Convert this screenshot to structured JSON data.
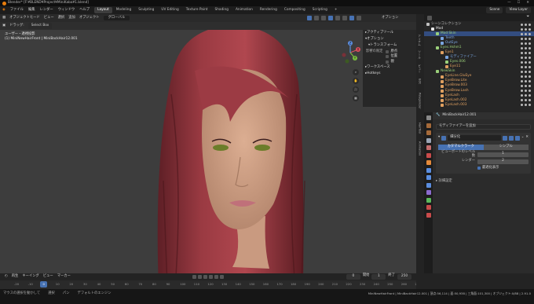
{
  "window": {
    "title": "Blender* [F:¥BLEND¥Project¥MiniKaba¥1.blend]",
    "controls": [
      "—",
      "☐",
      "✕"
    ]
  },
  "menubar": {
    "items": [
      "ファイル",
      "編集",
      "レンダー",
      "ウィンドウ",
      "ヘルプ"
    ],
    "workspaces": [
      "Layout",
      "Modeling",
      "Sculpting",
      "UV Editing",
      "Texture Paint",
      "Shading",
      "Animation",
      "Rendering",
      "Compositing",
      "Scripting",
      "+"
    ],
    "scene": "Scene",
    "view_layer": "View Layer"
  },
  "viewport": {
    "header": {
      "mode": "オブジェクトモード",
      "view": "ビュー",
      "select": "選択",
      "add": "追加",
      "object": "オブジェクト",
      "global": "グローバル",
      "options": "オプション"
    },
    "tool_header": {
      "items": [
        "ドラッグ:",
        "Select Box"
      ]
    },
    "info": [
      "ユーザー・透視投影",
      "(1) MiniNewHairFront | MiniBackHair12.001"
    ],
    "gizmo": {
      "x": "X",
      "y": "Y",
      "z": "Z"
    },
    "npanel": {
      "active_tool": "アクティブツール",
      "options": "オプション",
      "transform": "トランスフォーム",
      "affect_only": "影響の限定",
      "affect_items": [
        "原点",
        "位置",
        "親"
      ],
      "workspace": "ワークスペース",
      "hotkeys": "Hotkeys"
    },
    "nav_buttons": [
      "⌕",
      "✋",
      "🎥",
      "▦"
    ]
  },
  "side_tabs": [
    "アイテム",
    "ツール",
    "ビュー",
    "Edit",
    "Polygonizer",
    "HairTool",
    "Animation"
  ],
  "outliner": {
    "header": "",
    "rows": [
      {
        "name": "シーンコレクション",
        "indent": 0,
        "color": "#c0c0c0"
      },
      {
        "name": "Mod",
        "indent": 1,
        "color": "#e8e8e8"
      },
      {
        "name": "Mod Skin",
        "indent": 2,
        "color": "#9bd07a"
      },
      {
        "name": "Teeth",
        "indent": 3,
        "color": "#7aa5e0"
      },
      {
        "name": "OutEye",
        "indent": 3,
        "color": "#7aa5e0"
      },
      {
        "name": "Eyes.Hshm1",
        "indent": 2,
        "color": "#9bd07a"
      },
      {
        "name": "Eye1",
        "indent": 3,
        "color": "#e0a060"
      },
      {
        "name": "モディファイアー",
        "indent": 4,
        "color": "#7aa5e0"
      },
      {
        "name": "Eyes.006",
        "indent": 4,
        "color": "#9bd07a"
      },
      {
        "name": "Eye11",
        "indent": 4,
        "color": "#e0a060"
      },
      {
        "name": "NewSkin",
        "indent": 2,
        "color": "#9bd07a"
      },
      {
        "name": "EyeLine.GluEye",
        "indent": 3,
        "color": "#e0a060"
      },
      {
        "name": "EyeBrow.Lite",
        "indent": 3,
        "color": "#e0a060"
      },
      {
        "name": "EyeBrow.003",
        "indent": 3,
        "color": "#e0a060"
      },
      {
        "name": "EyeBrow.Lash",
        "indent": 3,
        "color": "#e0a060"
      },
      {
        "name": "EyeLash",
        "indent": 3,
        "color": "#e0a060"
      },
      {
        "name": "EyeLash.002",
        "indent": 3,
        "color": "#e0a060"
      },
      {
        "name": "EyeLash.003",
        "indent": 3,
        "color": "#e0a060"
      }
    ]
  },
  "properties": {
    "object_name": "MiniBackHair12.001",
    "add_modifier": "モディファイアーを追加",
    "modifier_name": "細分化",
    "tabs": [
      "カタマルクラーク",
      "シンプル"
    ],
    "rows": [
      {
        "label": "ビューポートのレベル数",
        "value": "1"
      },
      {
        "label": "レンダー",
        "value": "2"
      }
    ],
    "optimal": "最適化表示",
    "advanced": "詳細設定"
  },
  "timeline": {
    "header": [
      "再生",
      "キーイング",
      "ビュー",
      "マーカー"
    ],
    "frames": {
      "current": "0",
      "start_label": "開始",
      "start": "1",
      "end_label": "終了",
      "end": "250"
    },
    "ticks": [
      "-20",
      "-10",
      "0",
      "10",
      "20",
      "30",
      "40",
      "50",
      "60",
      "70",
      "80",
      "90",
      "100",
      "110",
      "120",
      "130",
      "140",
      "150",
      "160",
      "170",
      "180",
      "190",
      "200",
      "210",
      "220",
      "230",
      "240",
      "250",
      "260",
      "270"
    ],
    "current": "0"
  },
  "status": {
    "left": [
      "マウスの選択を動かして",
      "選択",
      "パン",
      "デフォルトのエンジン"
    ],
    "stats": "MiniNewHairFront | MiniBackHair12.001 | 頂点:56,114 | 面:50,938 | 三角面:101,300 | オブジェクト:0/88 | 2.91.0"
  },
  "colors": {
    "accent": "#4772b3",
    "orange": "#e87d0d",
    "bg": "#3d3d3d"
  }
}
